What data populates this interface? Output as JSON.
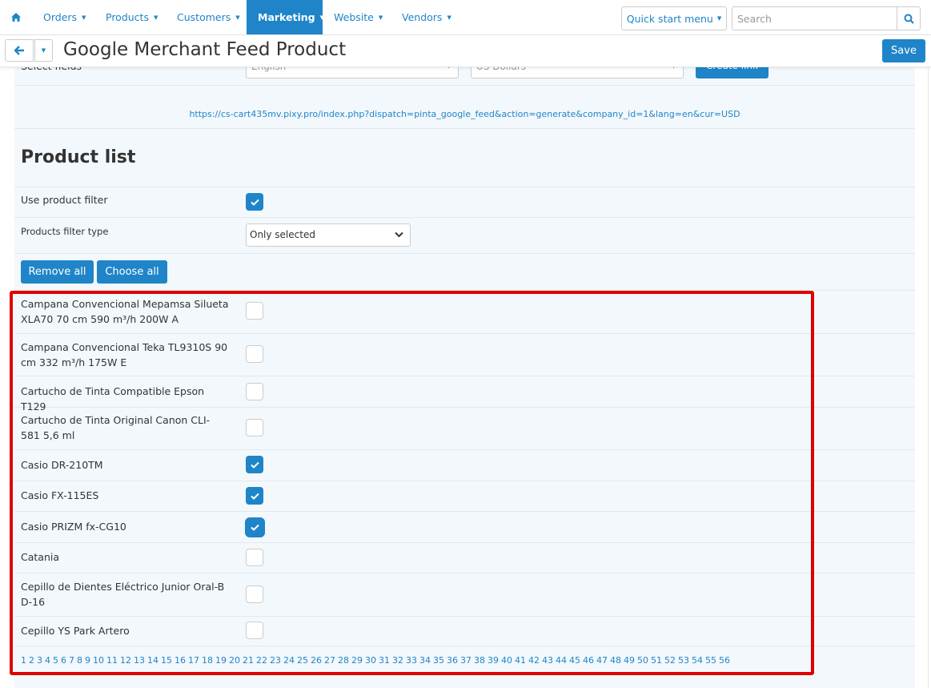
{
  "nav": {
    "items": [
      {
        "label": "Orders"
      },
      {
        "label": "Products"
      },
      {
        "label": "Customers"
      },
      {
        "label": "Marketing"
      },
      {
        "label": "Website"
      },
      {
        "label": "Vendors"
      }
    ],
    "active": "Marketing",
    "quick_start": "Quick start menu",
    "search_placeholder": "Search"
  },
  "header": {
    "title": "Google Merchant Feed Product",
    "save_label": "Save"
  },
  "partial": {
    "label": "Select fields",
    "lang_value": "English",
    "currency_value": "US Dollars",
    "create_link_label": "Create link"
  },
  "feed_link": "https://cs-cart435mv.pixy.pro/index.php?dispatch=pinta_google_feed&action=generate&company_id=1&lang=en&cur=USD",
  "product_section": {
    "title": "Product list",
    "use_filter_label": "Use product filter",
    "use_filter_checked": true,
    "filter_type_label": "Products filter type",
    "filter_type_value": "Only selected",
    "remove_all_label": "Remove all",
    "choose_all_label": "Choose all"
  },
  "products": [
    {
      "name": "Campana Convencional Mepamsa Silueta XLA70 70 cm 590 m³/h 200W A",
      "checked": false
    },
    {
      "name": "Campana Convencional Teka TL9310S 90 cm 332 m³/h 175W E",
      "checked": false
    },
    {
      "name": "Cartucho de Tinta Compatible Epson T129",
      "checked": false
    },
    {
      "name": "Cartucho de Tinta Original Canon CLI-581 5,6 ml",
      "checked": false
    },
    {
      "name": "Casio DR-210TM",
      "checked": true
    },
    {
      "name": "Casio FX-115ES",
      "checked": true
    },
    {
      "name": "Casio PRIZM fx-CG10",
      "checked": true
    },
    {
      "name": "Catania",
      "checked": false
    },
    {
      "name": "Cepillo de Dientes Eléctrico Junior Oral-B D-16",
      "checked": false
    },
    {
      "name": "Cepillo YS Park Artero",
      "checked": false
    }
  ],
  "pagination": [
    "1",
    "2",
    "3",
    "4",
    "5",
    "6",
    "7",
    "8",
    "9",
    "10",
    "11",
    "12",
    "13",
    "14",
    "15",
    "16",
    "17",
    "18",
    "19",
    "20",
    "21",
    "22",
    "23",
    "24",
    "25",
    "26",
    "27",
    "28",
    "29",
    "30",
    "31",
    "32",
    "33",
    "34",
    "35",
    "36",
    "37",
    "38",
    "39",
    "40",
    "41",
    "42",
    "43",
    "44",
    "45",
    "46",
    "47",
    "48",
    "49",
    "50",
    "51",
    "52",
    "53",
    "54",
    "55",
    "56"
  ],
  "colors": {
    "accent": "#1f85c8",
    "highlight": "#e00000",
    "content_bg": "#f3f8fc"
  }
}
